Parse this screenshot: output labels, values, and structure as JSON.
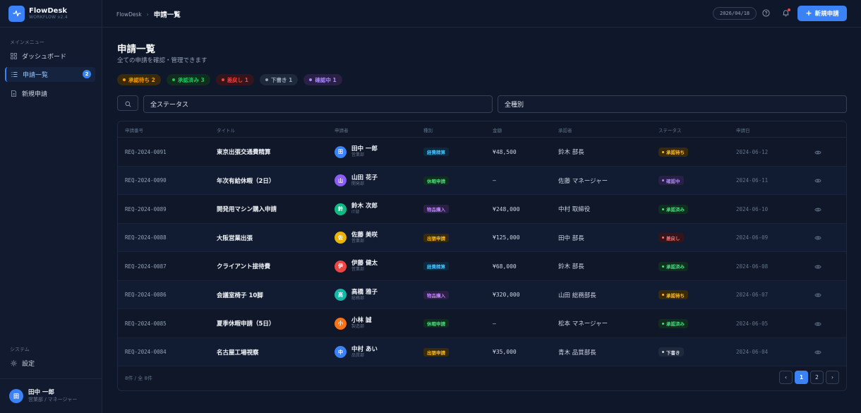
{
  "app": {
    "name": "FlowDesk",
    "version": "WORKFLOW v2.4"
  },
  "sidebar": {
    "main_label": "メインメニュー",
    "items": [
      {
        "label": "ダッシュボード",
        "icon": "grid-icon"
      },
      {
        "label": "申請一覧",
        "icon": "list-icon",
        "badge": "2",
        "active": true
      },
      {
        "label": "新規申請",
        "icon": "document-icon"
      }
    ],
    "system_label": "システム",
    "settings_label": "設定"
  },
  "user": {
    "initial": "田",
    "name": "田中 一郎",
    "role": "営業部 / マネージャー"
  },
  "header": {
    "breadcrumb_root": "FlowDesk",
    "breadcrumb_current": "申請一覧",
    "date": "2026/04/18",
    "new_button": "新規申請"
  },
  "page": {
    "title": "申請一覧",
    "subtitle": "全ての申請を確認・管理できます"
  },
  "summary_chips": [
    {
      "label": "承認待ち 2",
      "color": "#f59e0b",
      "bg": "#3a2a0c"
    },
    {
      "label": "承認済み 3",
      "color": "#22c55e",
      "bg": "#0f2e1e"
    },
    {
      "label": "差戻し 1",
      "color": "#ef4444",
      "bg": "#35151b"
    },
    {
      "label": "下書き 1",
      "color": "#94a3b8",
      "bg": "#1e293b"
    },
    {
      "label": "確認中 1",
      "color": "#a78bfa",
      "bg": "#2a1f45"
    }
  ],
  "filters": {
    "status": "全ステータス",
    "type": "全種別"
  },
  "table": {
    "headers": [
      "申請番号",
      "タイトル",
      "申請者",
      "種別",
      "金額",
      "承認者",
      "ステータス",
      "申請日"
    ],
    "rows": [
      {
        "id": "REQ-2024-0091",
        "title": "東京出張交通費精算",
        "initial": "田",
        "avatar_color": "#3b82f6",
        "name": "田中 一郎",
        "dept": "営業部",
        "type": "経費精算",
        "type_key": "expense",
        "amount": "¥48,500",
        "approver": "鈴木 部長",
        "status": "承認待ち",
        "status_key": "pending",
        "date": "2024-06-12"
      },
      {
        "id": "REQ-2024-0090",
        "title": "年次有給休暇（2日）",
        "initial": "山",
        "avatar_color": "#8b5cf6",
        "name": "山田 花子",
        "dept": "開発部",
        "type": "休暇申請",
        "type_key": "leave",
        "amount": "—",
        "approver": "佐藤 マネージャー",
        "status": "確認中",
        "status_key": "review",
        "date": "2024-06-11"
      },
      {
        "id": "REQ-2024-0089",
        "title": "開発用マシン購入申請",
        "initial": "鈴",
        "avatar_color": "#10b981",
        "name": "鈴木 次郎",
        "dept": "IT部",
        "type": "物品購入",
        "type_key": "purchase",
        "amount": "¥248,000",
        "approver": "中村 取締役",
        "status": "承認済み",
        "status_key": "approved",
        "date": "2024-06-10"
      },
      {
        "id": "REQ-2024-0088",
        "title": "大阪営業出張",
        "initial": "佐",
        "avatar_color": "#eab308",
        "name": "佐藤 美咲",
        "dept": "営業部",
        "type": "出張申請",
        "type_key": "trip",
        "amount": "¥125,000",
        "approver": "田中 部長",
        "status": "差戻し",
        "status_key": "rejected",
        "date": "2024-06-09"
      },
      {
        "id": "REQ-2024-0087",
        "title": "クライアント接待費",
        "initial": "伊",
        "avatar_color": "#ef4444",
        "name": "伊藤 健太",
        "dept": "営業部",
        "type": "経費精算",
        "type_key": "expense",
        "amount": "¥68,000",
        "approver": "鈴木 部長",
        "status": "承認済み",
        "status_key": "approved",
        "date": "2024-06-08"
      },
      {
        "id": "REQ-2024-0086",
        "title": "会議室椅子 10脚",
        "initial": "高",
        "avatar_color": "#14b8a6",
        "name": "高橋 雅子",
        "dept": "総務部",
        "type": "物品購入",
        "type_key": "purchase",
        "amount": "¥320,000",
        "approver": "山田 総務部長",
        "status": "承認待ち",
        "status_key": "pending",
        "date": "2024-06-07"
      },
      {
        "id": "REQ-2024-0085",
        "title": "夏季休暇申請（5日）",
        "initial": "小",
        "avatar_color": "#f97316",
        "name": "小林 誠",
        "dept": "製造部",
        "type": "休暇申請",
        "type_key": "leave",
        "amount": "—",
        "approver": "松本 マネージャー",
        "status": "承認済み",
        "status_key": "approved",
        "date": "2024-06-05"
      },
      {
        "id": "REQ-2024-0084",
        "title": "名古屋工場視察",
        "initial": "中",
        "avatar_color": "#3b82f6",
        "name": "中村 あい",
        "dept": "品質部",
        "type": "出張申請",
        "type_key": "trip",
        "amount": "¥35,000",
        "approver": "青木 品質部長",
        "status": "下書き",
        "status_key": "draft",
        "date": "2024-06-04"
      }
    ]
  },
  "footer": {
    "count": "8件 / 全 8件",
    "pages": [
      "1",
      "2"
    ],
    "current_page": "1"
  }
}
